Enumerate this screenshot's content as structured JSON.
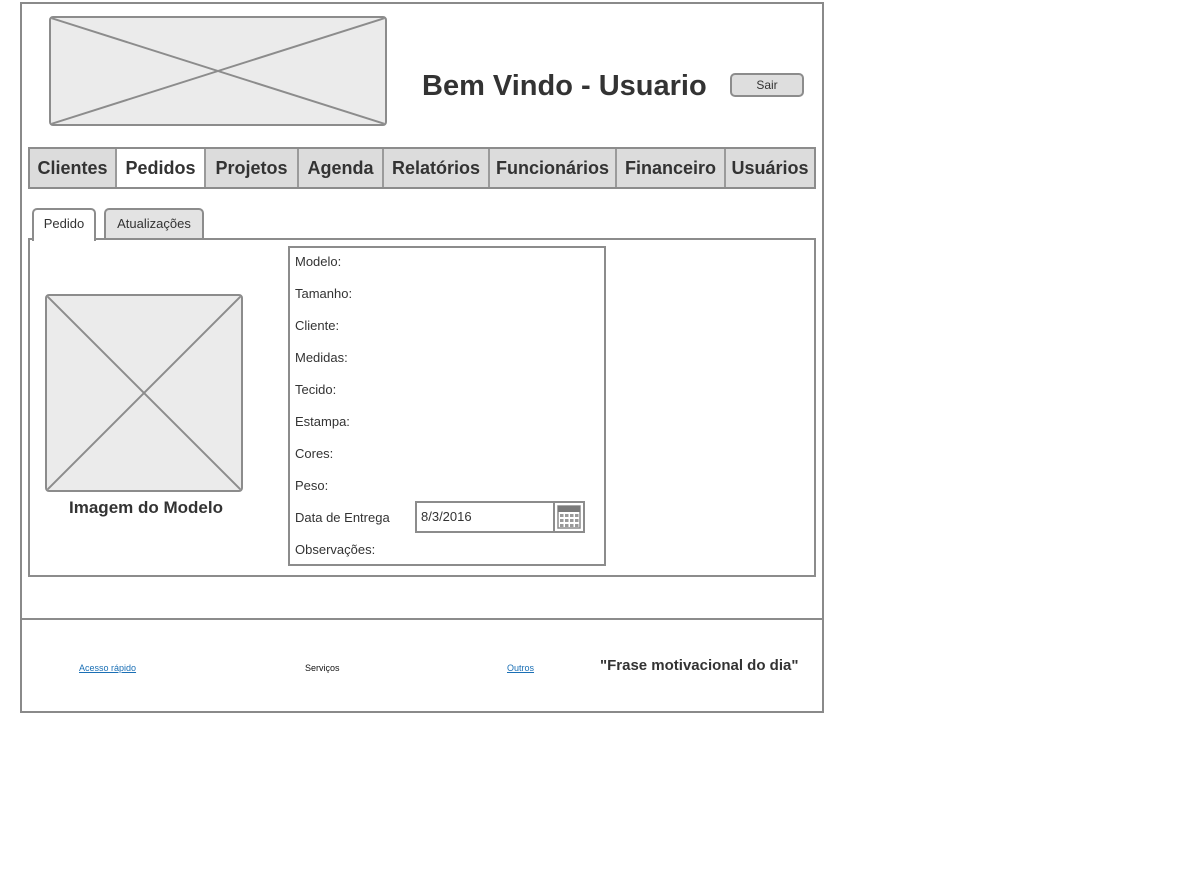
{
  "header": {
    "welcome_text": "Bem Vindo - Usuario",
    "logout_label": "Sair",
    "logo_icon": "image-placeholder-icon"
  },
  "nav": {
    "tabs": [
      {
        "label": "Clientes",
        "active": false
      },
      {
        "label": "Pedidos",
        "active": true
      },
      {
        "label": "Projetos",
        "active": false
      },
      {
        "label": "Agenda",
        "active": false
      },
      {
        "label": "Relatórios",
        "active": false
      },
      {
        "label": "Funcionários",
        "active": false
      },
      {
        "label": "Financeiro",
        "active": false
      },
      {
        "label": "Usuários",
        "active": false
      }
    ]
  },
  "subtabs": [
    {
      "label": "Pedido",
      "active": true
    },
    {
      "label": "Atualizações",
      "active": false
    }
  ],
  "model": {
    "image_icon": "image-placeholder-icon",
    "caption": "Imagem do Modelo"
  },
  "form": {
    "fields": [
      {
        "label": "Modelo:"
      },
      {
        "label": "Tamanho:"
      },
      {
        "label": "Cliente:"
      },
      {
        "label": "Medidas:"
      },
      {
        "label": "Tecido:"
      },
      {
        "label": "Estampa:"
      },
      {
        "label": "Cores:"
      },
      {
        "label": "Peso:"
      },
      {
        "label": "Data de Entrega"
      },
      {
        "label": "Observações:"
      }
    ],
    "delivery_date": {
      "value": "8/3/2016",
      "icon": "calendar-icon"
    }
  },
  "footer": {
    "quick_access": "Acesso rápido",
    "services": "Serviços",
    "others": "Outros",
    "quote": "\"Frase motivacional do dia\""
  },
  "colors": {
    "border": "#8c8c8c",
    "tab_bg": "#dcdcdc",
    "placeholder_bg": "#ebebeb",
    "link": "#1a6fb5",
    "text": "#333333"
  }
}
